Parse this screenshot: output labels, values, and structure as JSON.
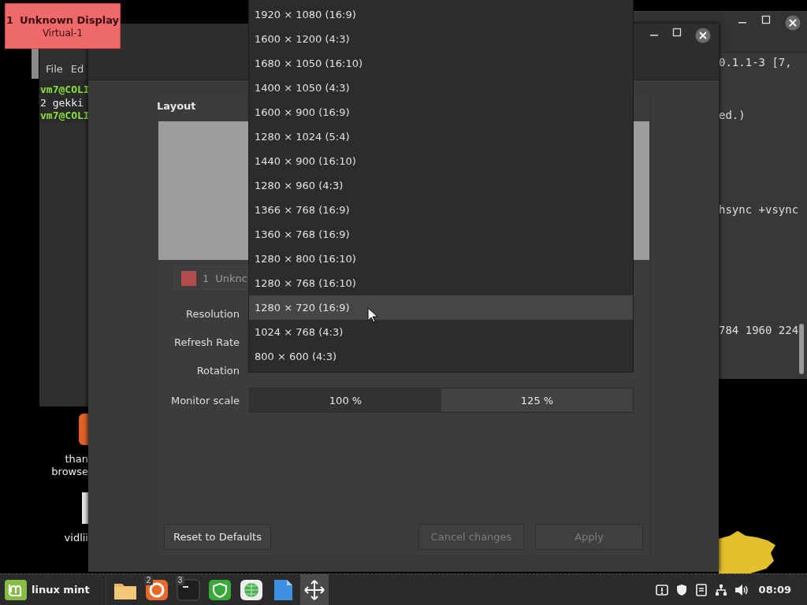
{
  "osd": {
    "number": "1",
    "title": "Unknown Display",
    "subtitle": "Virtual-1"
  },
  "terminal_left": {
    "menu": [
      "File",
      "Ed"
    ],
    "lines": [
      {
        "text": "vm7@COLI",
        "kind": "prompt"
      },
      {
        "text": "2 gekki",
        "kind": "output"
      },
      {
        "text": "vm7@COLI",
        "kind": "prompt"
      }
    ]
  },
  "terminal_right": {
    "lines": [
      "0.1.1-3 [7,",
      "ed.)",
      "hsync +vsync",
      "784 1960 224"
    ]
  },
  "desktop_icons": [
    {
      "kind": "app",
      "label": [
        "than",
        "browse"
      ]
    },
    {
      "kind": "file",
      "label": [
        "vidlii"
      ]
    }
  ],
  "display_settings": {
    "section": "Layout",
    "monitor": {
      "number": "1",
      "name": "Unknc",
      "color": "#b24c4c"
    },
    "rows": [
      "Resolution",
      "Refresh Rate",
      "Rotation",
      "Monitor scale"
    ],
    "scale_options": [
      {
        "label": "100 %",
        "selected": true
      },
      {
        "label": "125 %",
        "selected": false
      }
    ],
    "buttons": [
      {
        "label": "Reset to Defaults",
        "disabled": false
      },
      {
        "label": "Cancel changes",
        "disabled": true
      },
      {
        "label": "Apply",
        "disabled": true
      }
    ]
  },
  "resolution_menu": {
    "items": [
      {
        "label": "1920 × 1080 (16:9)",
        "hovered": false
      },
      {
        "label": "1600 × 1200 (4:3)",
        "hovered": false
      },
      {
        "label": "1680 × 1050 (16:10)",
        "hovered": false
      },
      {
        "label": "1400 × 1050 (4:3)",
        "hovered": false
      },
      {
        "label": "1600 × 900 (16:9)",
        "hovered": false
      },
      {
        "label": "1280 × 1024 (5:4)",
        "hovered": false
      },
      {
        "label": "1440 × 900 (16:10)",
        "hovered": false
      },
      {
        "label": "1280 × 960 (4:3)",
        "hovered": false
      },
      {
        "label": "1366 × 768 (16:9)",
        "hovered": false
      },
      {
        "label": "1360 × 768 (16:9)",
        "hovered": false
      },
      {
        "label": "1280 × 800 (16:10)",
        "hovered": false
      },
      {
        "label": "1280 × 768 (16:10)",
        "hovered": false
      },
      {
        "label": "1280 × 720 (16:9)",
        "hovered": true
      },
      {
        "label": "1024 × 768 (4:3)",
        "hovered": false
      },
      {
        "label": "800 × 600 (4:3)",
        "hovered": false
      }
    ]
  },
  "taskbar": {
    "menu_label": "linux mint",
    "apps": [
      {
        "kind": "folder",
        "active": false
      },
      {
        "kind": "browser",
        "badge": "2",
        "active": false
      },
      {
        "kind": "terminal",
        "badge": "3",
        "active": false
      },
      {
        "kind": "shield",
        "active": false
      },
      {
        "kind": "globe",
        "active": false
      },
      {
        "kind": "document",
        "active": false
      },
      {
        "kind": "move",
        "active": true
      }
    ],
    "clock": "08:09"
  }
}
